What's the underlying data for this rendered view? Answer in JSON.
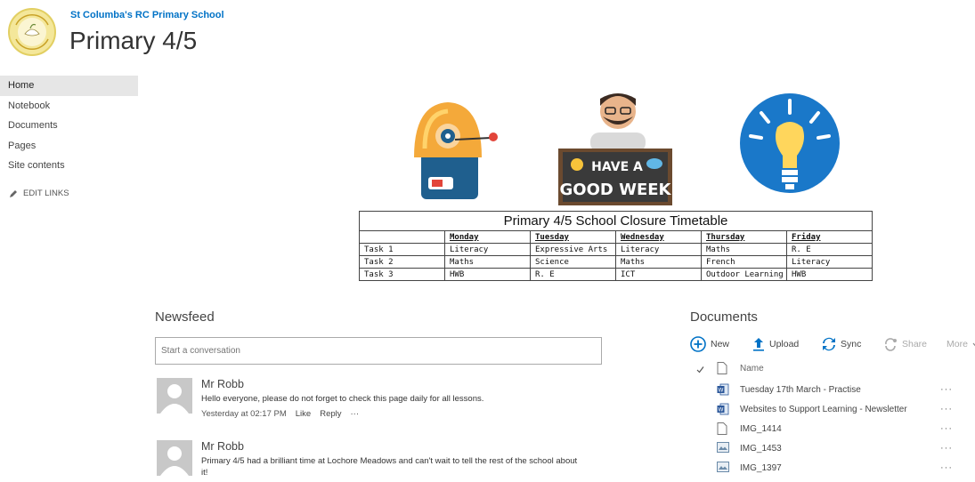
{
  "header": {
    "site_link": "St Columba's RC Primary School",
    "title": "Primary 4/5"
  },
  "logo": {
    "text": "St Columba's Primary School"
  },
  "nav": {
    "items": [
      {
        "label": "Home"
      },
      {
        "label": "Notebook"
      },
      {
        "label": "Documents"
      },
      {
        "label": "Pages"
      },
      {
        "label": "Site contents"
      }
    ],
    "edit_links": "EDIT LINKS"
  },
  "banner": {
    "sign_line1": "HAVE A",
    "sign_line2": "GOOD WEEK"
  },
  "timetable": {
    "title": "Primary 4/5 School Closure Timetable",
    "days": [
      "Monday",
      "Tuesday",
      "Wednesday",
      "Thursday",
      "Friday"
    ],
    "rows": [
      {
        "task": "Task 1",
        "cells": [
          "Literacy",
          "Expressive Arts",
          "Literacy",
          "Maths",
          "R. E"
        ]
      },
      {
        "task": "Task 2",
        "cells": [
          "Maths",
          "Science",
          "Maths",
          "French",
          "Literacy"
        ]
      },
      {
        "task": "Task 3",
        "cells": [
          "HWB",
          "R. E",
          "ICT",
          "Outdoor Learning",
          "HWB"
        ]
      }
    ]
  },
  "newsfeed": {
    "title": "Newsfeed",
    "placeholder": "Start a conversation",
    "posts": [
      {
        "author": "Mr Robb",
        "text": "Hello everyone, please do not forget to check this page daily for all lessons.",
        "time": "Yesterday at 02:17 PM",
        "like": "Like",
        "reply": "Reply",
        "more": "···"
      },
      {
        "author": "Mr Robb",
        "text": "Primary 4/5 had a brilliant time at Lochore Meadows and can't wait to tell the rest of the school about it!"
      }
    ]
  },
  "documents": {
    "title": "Documents",
    "toolbar": {
      "new": "New",
      "upload": "Upload",
      "sync": "Sync",
      "share": "Share",
      "more": "More"
    },
    "column_name": "Name",
    "files": [
      {
        "name": "Tuesday 17th March - Practise",
        "icon": "word-icon"
      },
      {
        "name": "Websites to Support Learning - Newsletter",
        "icon": "word-icon"
      },
      {
        "name": "IMG_1414",
        "icon": "file-icon"
      },
      {
        "name": "IMG_1453",
        "icon": "image-icon"
      },
      {
        "name": "IMG_1397",
        "icon": "image-icon"
      }
    ],
    "dots": "···"
  },
  "colors": {
    "accent": "#0072c6",
    "nav_active": "#e6e6e6"
  }
}
